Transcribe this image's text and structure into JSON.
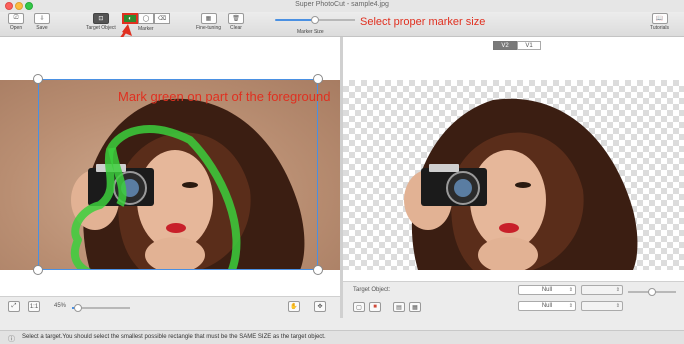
{
  "window": {
    "title": "Super PhotoCut - sample4.jpg"
  },
  "toolbar": {
    "open_label": "Open",
    "save_label": "Save",
    "target_object_label": "Target Object",
    "marker_label": "Marker",
    "fine_tuning_label": "Fine-tuning",
    "clear_label": "Clear",
    "marker_size_label": "Marker Size",
    "marker_size_value": 0.5,
    "tutorials_label": "Tutorials"
  },
  "annotations": {
    "marker_size_hint": "Select proper marker size",
    "mark_green_hint": "Mark green on part of the foreground"
  },
  "preview": {
    "tabs": [
      "V2",
      "V1"
    ],
    "active_tab": "V2"
  },
  "left_bottom": {
    "zoom_label": "45%",
    "zoom_value": 0.1
  },
  "right_bottom": {
    "target_object_label": "Target Object:",
    "select1": "Null",
    "select2": "",
    "select3": "Null",
    "select4": ""
  },
  "status": {
    "text": "Select a target.You should select the smallest possible rectangle that must be the SAME SIZE as the target object."
  },
  "colors": {
    "accent": "#4a90e2",
    "annotation": "#e03020",
    "marker_green": "#3ccf3c",
    "active_marker": "#2f8a2f"
  }
}
